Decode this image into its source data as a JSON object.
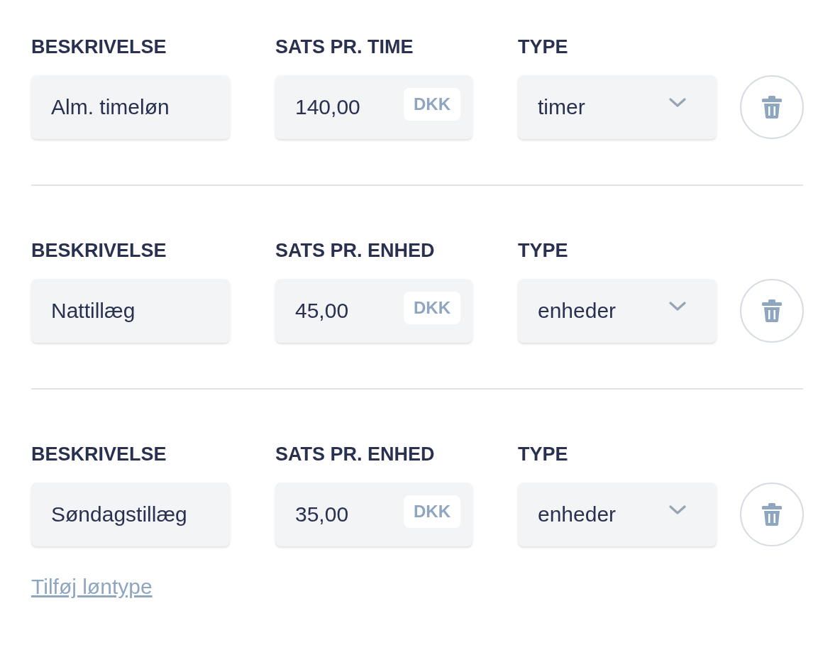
{
  "rows": [
    {
      "description_label": "BESKRIVELSE",
      "rate_label": "SATS PR. TIME",
      "type_label": "TYPE",
      "description": "Alm. timeløn",
      "rate": "140,00",
      "currency": "DKK",
      "type": "timer"
    },
    {
      "description_label": "BESKRIVELSE",
      "rate_label": "SATS PR. ENHED",
      "type_label": "TYPE",
      "description": "Nattillæg",
      "rate": "45,00",
      "currency": "DKK",
      "type": "enheder"
    },
    {
      "description_label": "BESKRIVELSE",
      "rate_label": "SATS PR. ENHED",
      "type_label": "TYPE",
      "description": "Søndagstillæg",
      "rate": "35,00",
      "currency": "DKK",
      "type": "enheder"
    }
  ],
  "add_link": "Tilføj løntype"
}
